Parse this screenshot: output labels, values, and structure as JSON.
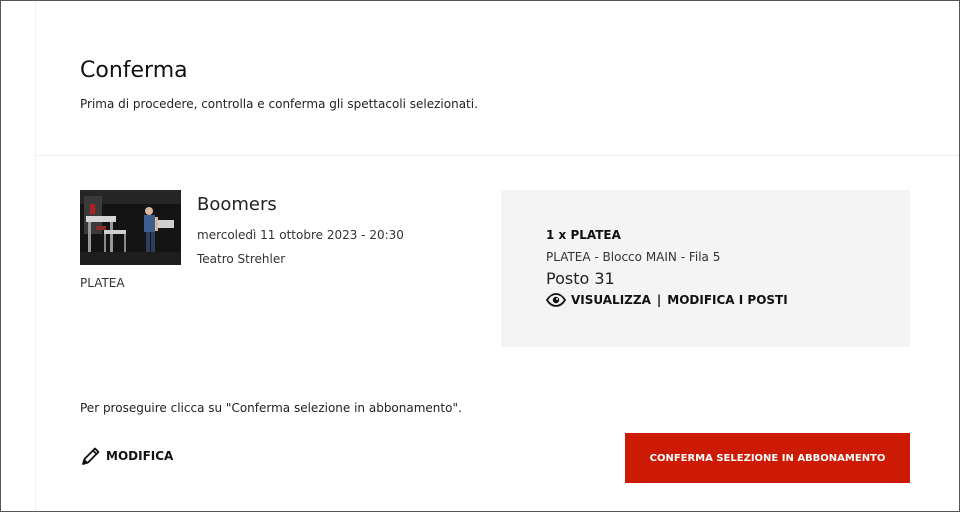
{
  "header": {
    "title": "Conferma",
    "subtitle": "Prima di procedere, controlla e conferma gli spettacoli selezionati."
  },
  "show": {
    "thumbnail_icon": "show-photo",
    "title": "Boomers",
    "date": "mercoledì 11 ottobre 2023 - 20:30",
    "venue": "Teatro Strehler",
    "sector": "PLATEA"
  },
  "seat": {
    "quantity": "1 x PLATEA",
    "location": "PLATEA - Blocco MAIN - Fila 5",
    "number": "Posto 31",
    "view_icon": "eye-icon",
    "view_label": "VISUALIZZA",
    "separator": "|",
    "modify_label": "MODIFICA I POSTI"
  },
  "footer": {
    "instruction": "Per proseguire clicca su \"Conferma selezione in abbonamento\".",
    "modify_icon": "pencil-icon",
    "modify_label": "MODIFICA",
    "confirm_label": "CONFERMA SELEZIONE IN ABBONAMENTO"
  },
  "colors": {
    "accent": "#cc1a05",
    "panel_background": "#f4f4f4"
  }
}
